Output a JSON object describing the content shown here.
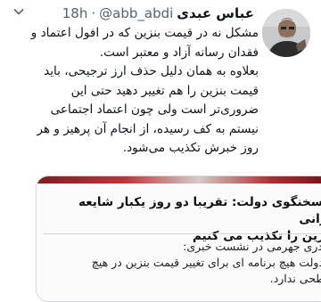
{
  "tweet": {
    "display_name": "عباس عبدی",
    "handle": "@abb_abdi",
    "separator": "·",
    "time": "18h",
    "body_lines": [
      "مشکل نه در قیمت بنزین که در افول اعتماد و",
      "فقدان رسانه آزاد و معتبر است.",
      "بعلاوه به همان دلیل حذف ارز ترجیحی، باید",
      "قیمت بنزین را هم تغییر دهید حتی این",
      "ضروری‌تر است ولی چون اعتماد اجتماعی",
      "نیستم به کف رسیده، از انجام آن پرهیز و هر",
      "روز خبرش تکذیب می‌شود."
    ]
  },
  "card": {
    "headline_line1": "سخنگوی دولت: تقریبا دو روز یکبار شایعه گرانی",
    "headline_line2": "بنزین را تکذیب می کنیم",
    "body_line1": "بهادری جهرمی در نشست خبری:",
    "body_line2": "دولت هیچ برنامه ای برای تغییر قیمت بنزین در هیچ",
    "body_line3": "سطحی ندارد."
  }
}
